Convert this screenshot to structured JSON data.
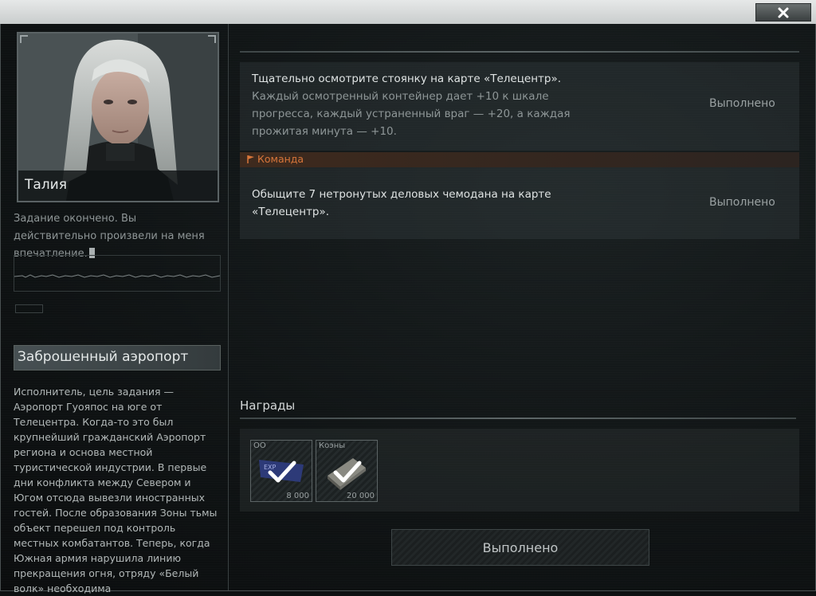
{
  "window": {
    "close_icon": "close-x-icon"
  },
  "character": {
    "name": "Талия",
    "dialog": "Задание окончено. Вы действительно произвели на меня впечатление."
  },
  "mission": {
    "title": "Заброшенный аэропорт",
    "description": "Исполнитель, цель задания — Аэропорт Гуояпос на юге от Телецентра. Когда-то это был крупнейший гражданский Аэропорт региона и основа местной туристической индустрии. В первые дни конфликта между Севером и Югом отсюда вывезли иностранных гостей. После образования Зоны тьмы объект перешел под контроль местных комбатантов. Теперь, когда Южная армия нарушила линию прекращения огня, отряду «Белый волк» необходима"
  },
  "objectives": [
    {
      "part1": "Тщательно осмотрите ",
      "highlight": "стоянку",
      "part2": " на карте «Телецентр».",
      "details": "Каждый осмотренный контейнер дает +10 к шкале прогресса, каждый устраненный враг — +20, а каждая прожитая минута — +10.",
      "status": "Выполнено"
    },
    {
      "section_label": "Команда",
      "section_icon": "flag-icon",
      "part1": "Обыщите 7 нетронутых ",
      "highlight": "деловых чемодана",
      "part2": " на карте «Телецентр».",
      "status": "Выполнено"
    }
  ],
  "rewards": {
    "title": "Награды",
    "items": [
      {
        "label": "ОО",
        "quantity": "8 000",
        "icon": "exp-card-icon"
      },
      {
        "label": "Коэны",
        "quantity": "20 000",
        "icon": "coin-stack-icon"
      }
    ]
  },
  "complete_button": "Выполнено",
  "colors": {
    "accent_orange": "#d8763a",
    "panel_bg": "#101415",
    "highlight_text": "#dfe3e3"
  }
}
